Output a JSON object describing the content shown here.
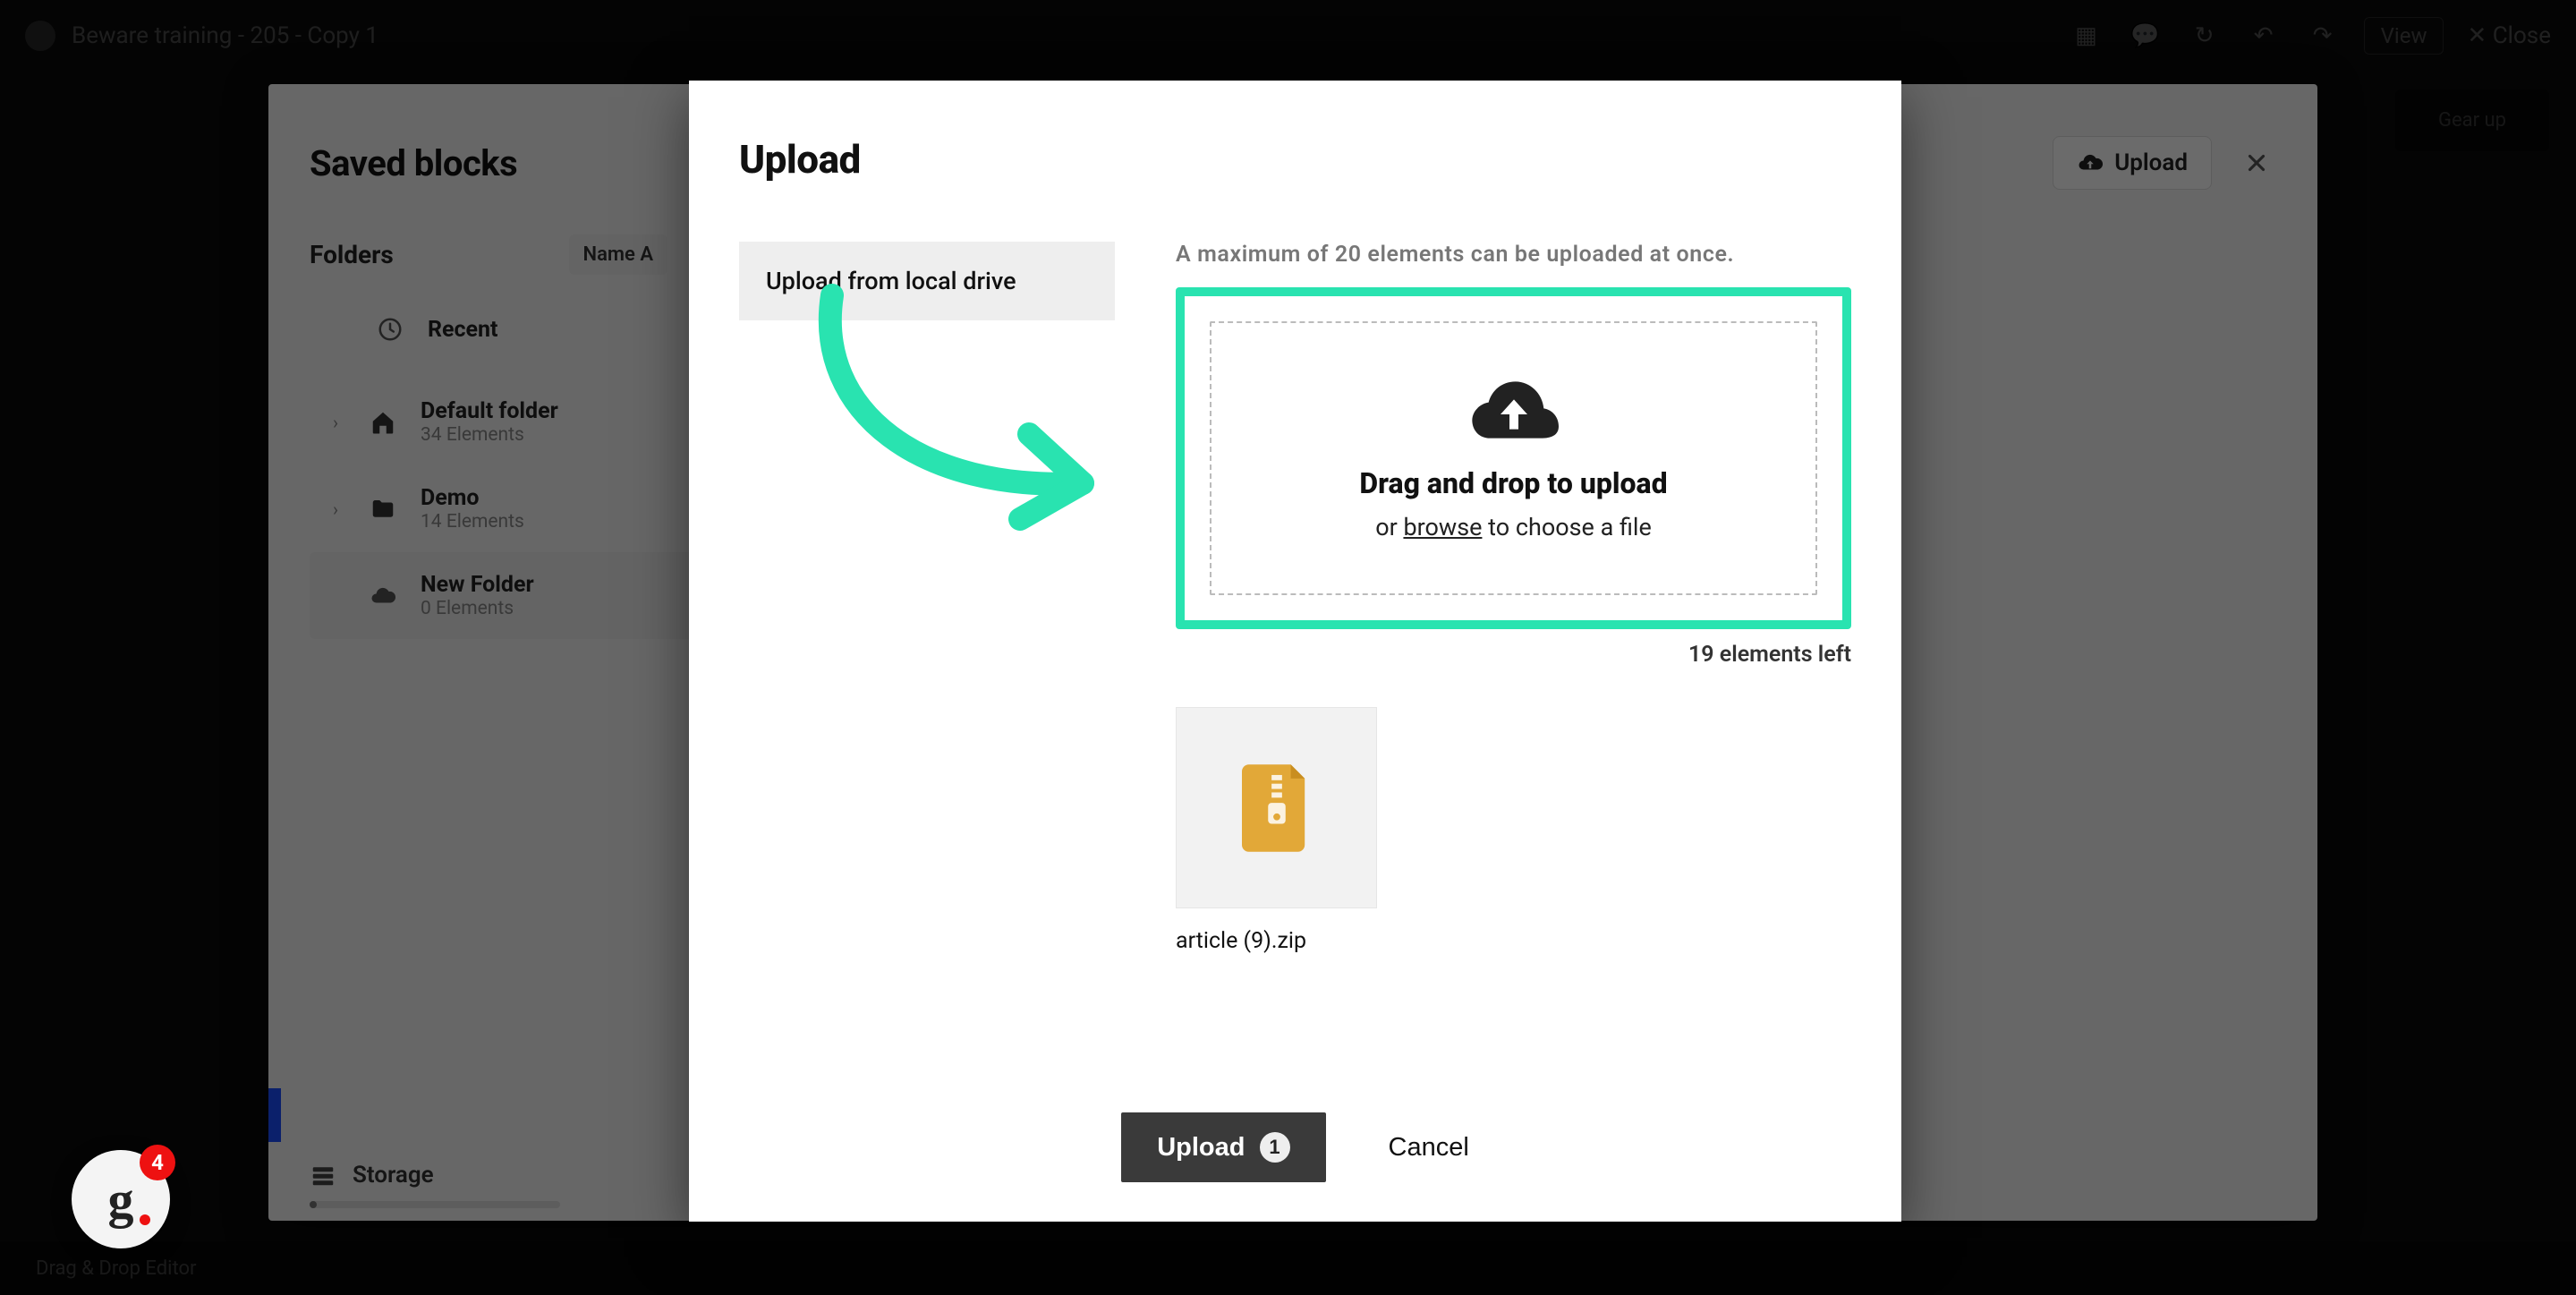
{
  "topbar": {
    "doc_title": "Beware training - 205 - Copy 1",
    "view_label": "View",
    "close_label": "✕  Close"
  },
  "blocks_panel": {
    "title": "Saved blocks",
    "upload_btn": "Upload",
    "folders_label": "Folders",
    "sort_label": "Name A",
    "recent_label": "Recent",
    "folders": [
      {
        "name": "Default folder",
        "count": "34 Elements"
      },
      {
        "name": "Demo",
        "count": "14 Elements"
      },
      {
        "name": "New Folder",
        "count": "0 Elements"
      }
    ],
    "storage_label": "Storage"
  },
  "upload_modal": {
    "title": "Upload",
    "tab_local": "Upload from local drive",
    "max_note": "A maximum of 20 elements can be uploaded at once.",
    "drop_title": "Drag and drop to upload",
    "drop_or": "or ",
    "drop_browse": "browse",
    "drop_rest": " to choose a file",
    "elements_left": "19 elements left",
    "file_name": "article (9).zip",
    "upload_btn": "Upload",
    "upload_count": "1",
    "cancel_btn": "Cancel"
  },
  "right_rail": {
    "go_btn": "Gear up"
  },
  "bottom": {
    "left_label": "Drag & Drop Editor"
  },
  "badge": {
    "count": "4"
  },
  "icons": {
    "cloud_upload": "cloud-upload-icon",
    "close": "close-icon",
    "clock": "clock-icon",
    "home": "home-icon",
    "folder": "folder-icon",
    "upload_folder": "cloud-icon",
    "storage": "storage-icon",
    "zip": "zip-file-icon"
  }
}
